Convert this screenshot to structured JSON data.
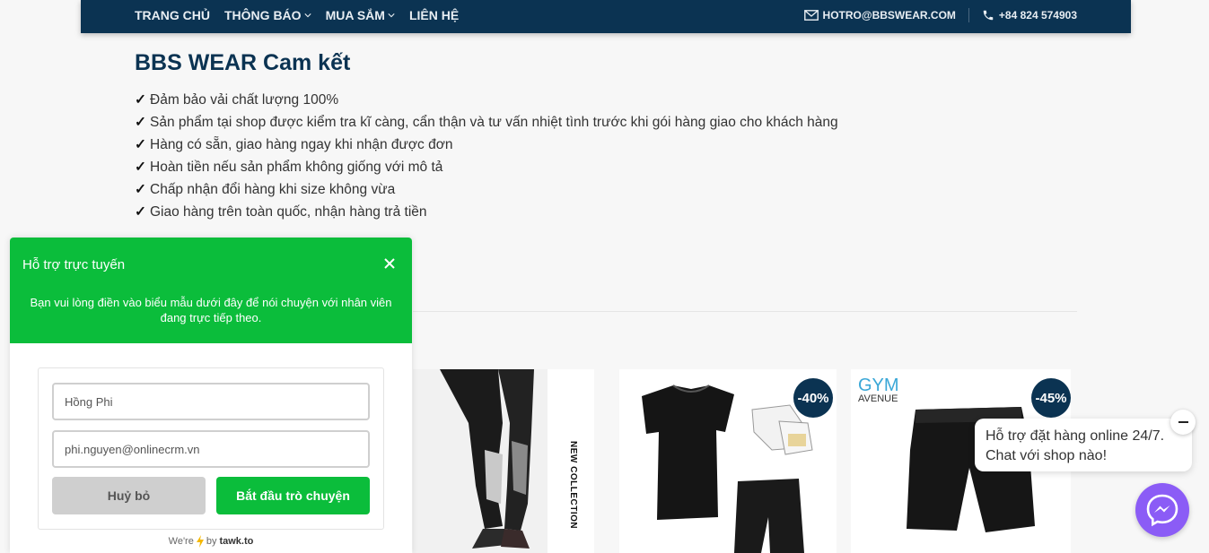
{
  "nav": {
    "items": [
      {
        "label": "TRANG CHỦ",
        "dropdown": false
      },
      {
        "label": "THÔNG BÁO",
        "dropdown": true
      },
      {
        "label": "MUA SẮM",
        "dropdown": true
      },
      {
        "label": "LIÊN HỆ",
        "dropdown": false
      }
    ],
    "email": "HOTRO@BBSWEAR.COM",
    "phone": "+84 824 574903"
  },
  "commitment": {
    "title": "BBS WEAR Cam kết",
    "check_mark": "✓",
    "items": [
      "Đảm bảo vải chất lượng 100%",
      "Sản phẩm tại shop được kiểm tra kĩ càng, cẩn thận và tư vấn nhiệt tình trước khi gói hàng giao cho khách hàng",
      "Hàng có sẵn, giao hàng ngay khi nhận được đơn",
      "Hoàn tiền nếu sản phẩm không giống với mô tả",
      "Chấp nhận đổi hàng khi size không vừa",
      "Giao hàng trên toàn quốc, nhận hàng trả tiền"
    ]
  },
  "products": {
    "card1": {
      "vertical_text": "NEW COLLECTION"
    },
    "card2": {
      "badge": "-40%"
    },
    "card3": {
      "badge": "-45%",
      "brand_line1": "GYM",
      "brand_line2": "AVENUE"
    }
  },
  "chat": {
    "title": "Hỗ trợ trực tuyến",
    "subtitle": "Bạn vui lòng điền vào biểu mẫu dưới đây để nói chuyện với nhân viên đang trực tiếp theo.",
    "name_value": "Hồng Phi",
    "email_value": "phi.nguyen@onlinecrm.vn",
    "cancel_label": "Huỷ bỏ",
    "start_label": "Bắt đầu trò chuyện",
    "powered_prefix": "We're",
    "powered_by": "by",
    "powered_brand": "tawk.to",
    "accent": "#0bbd3b"
  },
  "messenger": {
    "bubble_text": "Hỗ trợ đặt hàng online 24/7. Chat với shop nào!",
    "color": "#8b5cf6"
  },
  "colors": {
    "nav_bg": "#0b3352",
    "title": "#0b3352"
  }
}
